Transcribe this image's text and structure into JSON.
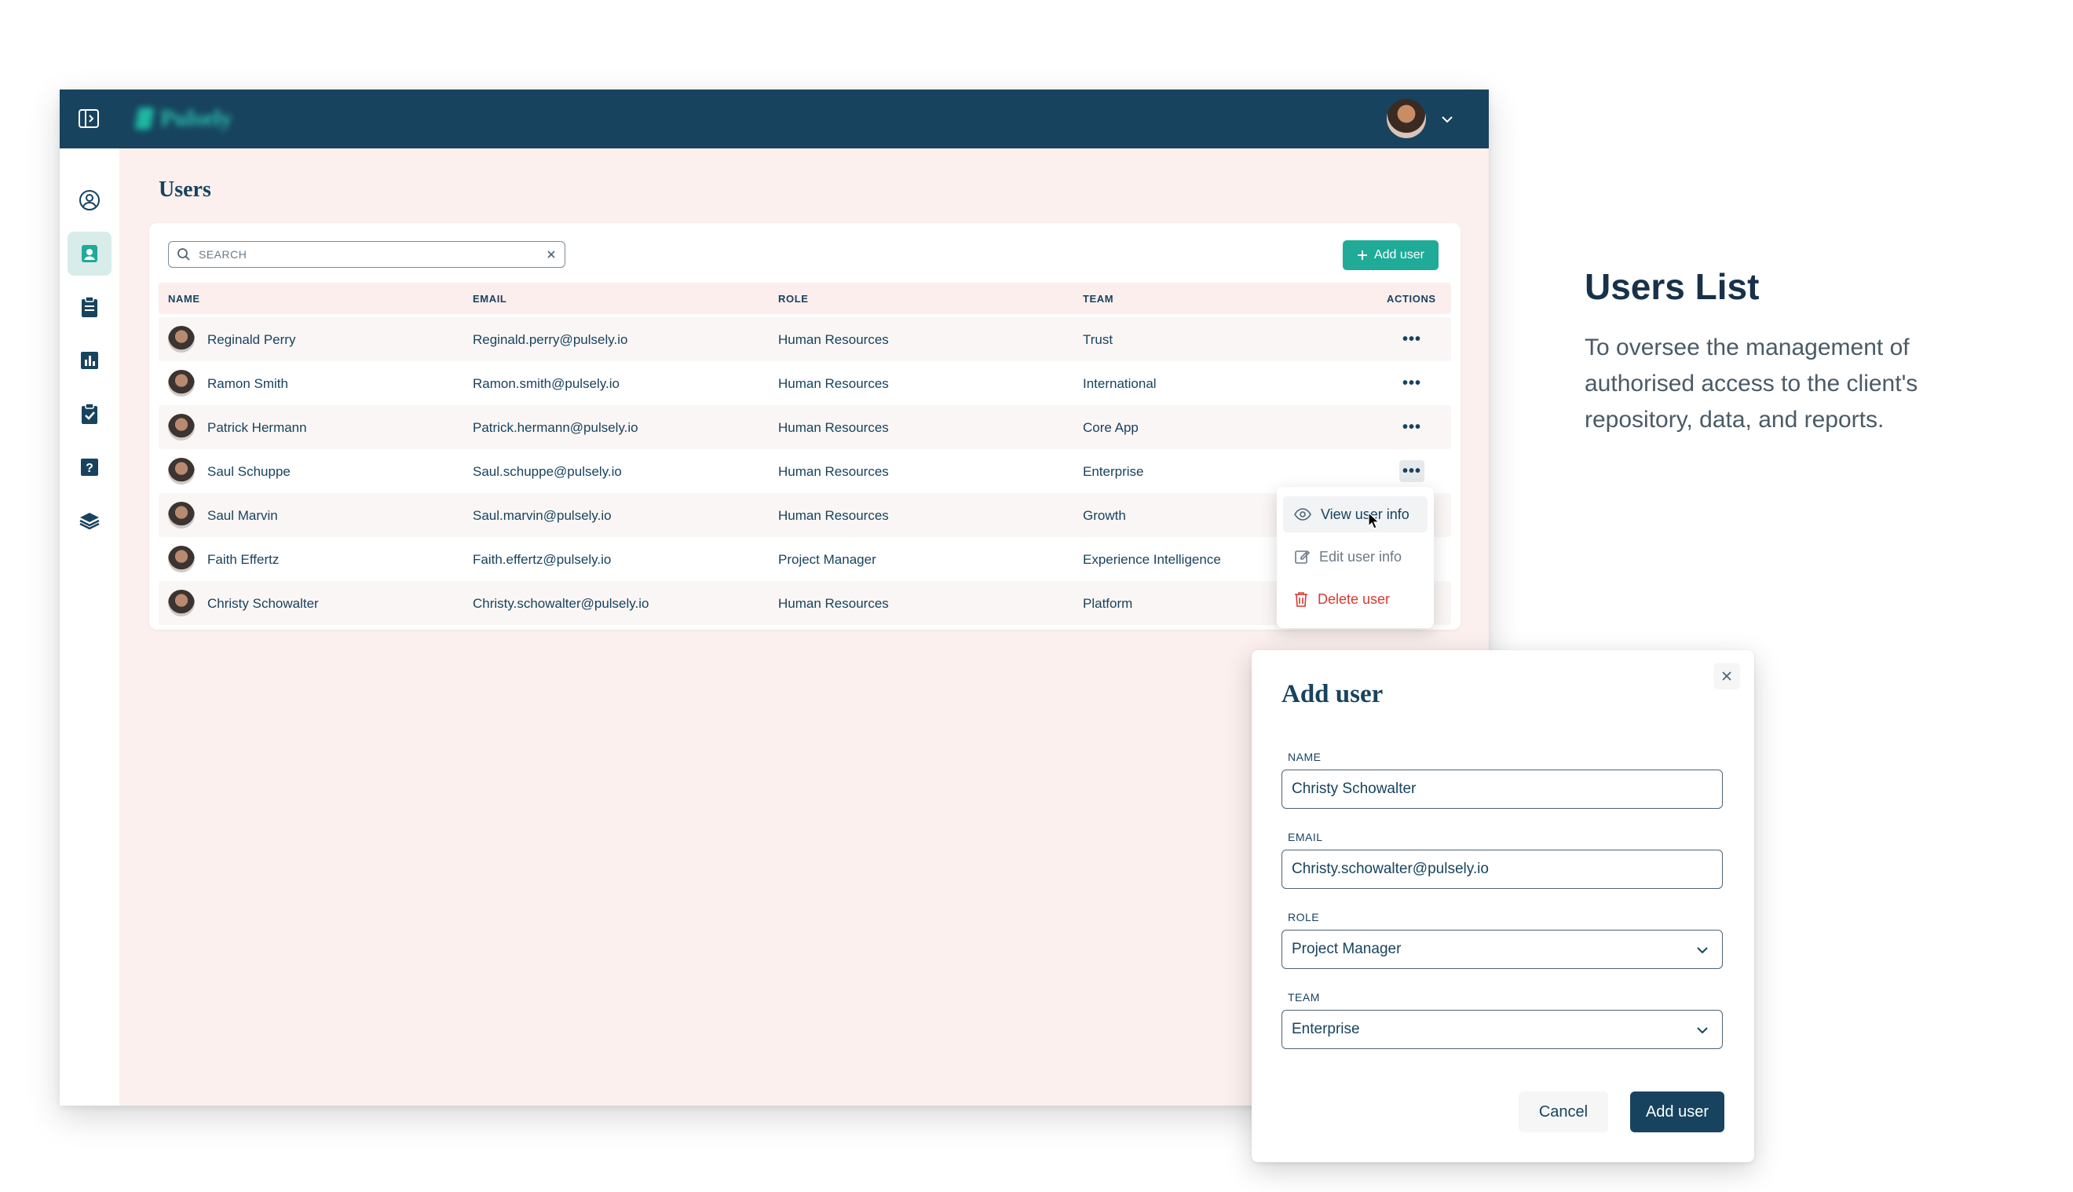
{
  "app": {
    "logo_text": "Pulsely"
  },
  "page": {
    "title": "Users"
  },
  "search": {
    "placeholder": "SEARCH"
  },
  "toolbar": {
    "add_user_label": "Add user"
  },
  "table": {
    "headers": {
      "name": "NAME",
      "email": "EMAIL",
      "role": "ROLE",
      "team": "TEAM",
      "actions": "ACTIONS"
    },
    "rows": [
      {
        "name": "Reginald Perry",
        "email": "Reginald.perry@pulsely.io",
        "role": "Human Resources",
        "team": "Trust"
      },
      {
        "name": "Ramon Smith",
        "email": "Ramon.smith@pulsely.io",
        "role": "Human Resources",
        "team": "International"
      },
      {
        "name": "Patrick Hermann",
        "email": "Patrick.hermann@pulsely.io",
        "role": "Human Resources",
        "team": "Core App"
      },
      {
        "name": "Saul Schuppe",
        "email": "Saul.schuppe@pulsely.io",
        "role": "Human Resources",
        "team": "Enterprise"
      },
      {
        "name": "Saul Marvin",
        "email": "Saul.marvin@pulsely.io",
        "role": "Human Resources",
        "team": "Growth"
      },
      {
        "name": "Faith Effertz",
        "email": "Faith.effertz@pulsely.io",
        "role": "Project Manager",
        "team": "Experience Intelligence"
      },
      {
        "name": "Christy Schowalter",
        "email": "Christy.schowalter@pulsely.io",
        "role": "Human Resources",
        "team": "Platform"
      }
    ],
    "actions_glyph": "•••"
  },
  "context_menu": {
    "view": "View user info",
    "edit": "Edit user info",
    "delete": "Delete user"
  },
  "dialog": {
    "title": "Add user",
    "name_label": "NAME",
    "name_value": "Christy Schowalter",
    "email_label": "EMAIL",
    "email_value": "Christy.schowalter@pulsely.io",
    "role_label": "ROLE",
    "role_value": "Project Manager",
    "team_label": "TEAM",
    "team_value": "Enterprise",
    "cancel_label": "Cancel",
    "submit_label": "Add user"
  },
  "info": {
    "title": "Users List",
    "description": "To oversee the management of authorised access to the client's repository, data, and reports."
  },
  "colors": {
    "topbar": "#17435e",
    "accent": "#1fab97",
    "danger": "#d93a2f",
    "page_bg": "#fbf0ee"
  }
}
